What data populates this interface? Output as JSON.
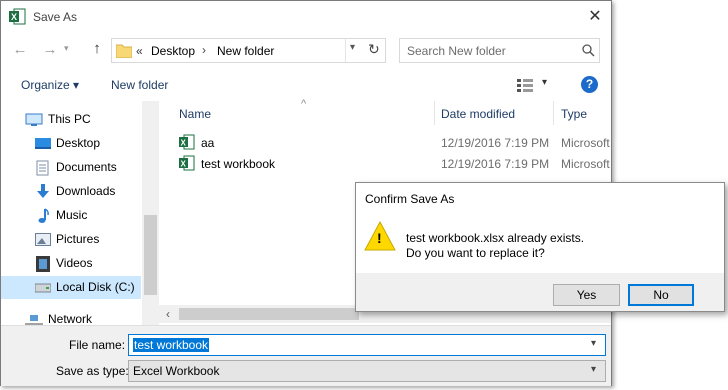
{
  "window": {
    "title": "Save As",
    "close_glyph": "✕",
    "app_icon": "excel-icon"
  },
  "nav": {
    "back": "←",
    "forward": "→",
    "up": "↑"
  },
  "address": {
    "overflow": "«",
    "crumbs": [
      "Desktop",
      "New folder"
    ],
    "separator": "›",
    "refresh": "↻"
  },
  "search": {
    "placeholder": "Search New folder"
  },
  "toolbar": {
    "organize": "Organize ▾",
    "new_folder": "New folder",
    "view_caret": "▾",
    "help": "?"
  },
  "sidebar": {
    "items": [
      {
        "label": "This PC",
        "icon": "monitor-icon"
      },
      {
        "label": "Desktop",
        "icon": "desktop-icon"
      },
      {
        "label": "Documents",
        "icon": "documents-icon"
      },
      {
        "label": "Downloads",
        "icon": "downloads-icon"
      },
      {
        "label": "Music",
        "icon": "music-icon"
      },
      {
        "label": "Pictures",
        "icon": "pictures-icon"
      },
      {
        "label": "Videos",
        "icon": "videos-icon"
      },
      {
        "label": "Local Disk (C:)",
        "icon": "disk-icon"
      },
      {
        "label": "Network",
        "icon": "network-icon"
      }
    ]
  },
  "files": {
    "columns": [
      "Name",
      "Date modified",
      "Type"
    ],
    "rows": [
      {
        "name": "aa",
        "date": "12/19/2016 7:19 PM",
        "type": "Microsoft"
      },
      {
        "name": "test workbook",
        "date": "12/19/2016 7:19 PM",
        "type": "Microsoft"
      }
    ]
  },
  "form": {
    "file_name_label": "File name:",
    "file_name_value": "test workbook",
    "save_type_label": "Save as type:",
    "save_type_value": "Excel Workbook"
  },
  "dialog": {
    "title": "Confirm Save As",
    "line1": "test workbook.xlsx already exists.",
    "line2": "Do you want to replace it?",
    "yes": "Yes",
    "no": "No",
    "warning_glyph": "!"
  }
}
